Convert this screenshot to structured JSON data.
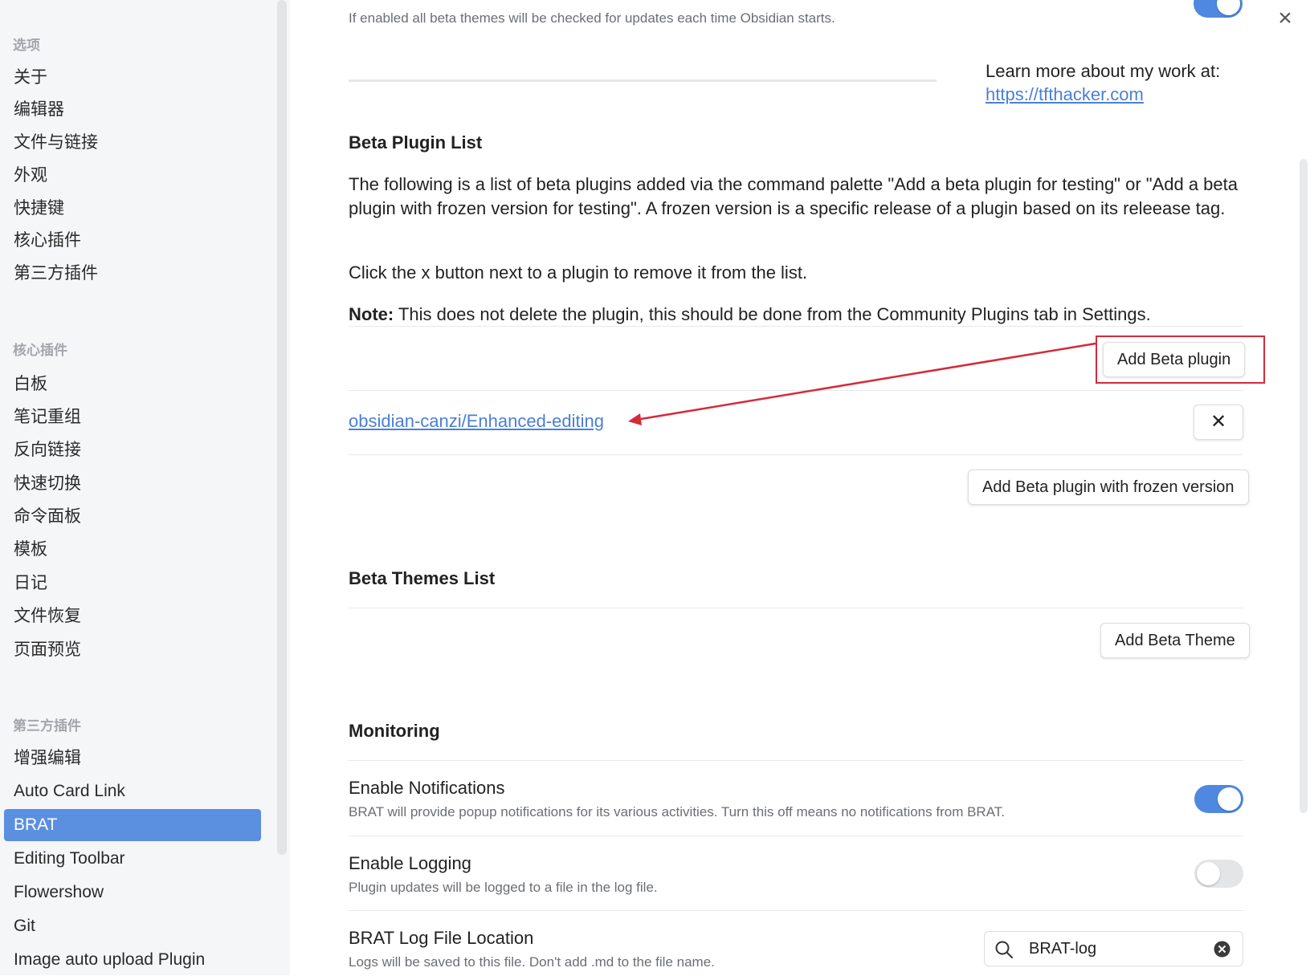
{
  "sidebar": {
    "sections": [
      {
        "title": "选项",
        "items": [
          "关于",
          "编辑器",
          "文件与链接",
          "外观",
          "快捷键",
          "核心插件",
          "第三方插件"
        ]
      },
      {
        "title": "核心插件",
        "items": [
          "白板",
          "笔记重组",
          "反向链接",
          "快速切换",
          "命令面板",
          "模板",
          "日记",
          "文件恢复",
          "页面预览"
        ]
      },
      {
        "title": "第三方插件",
        "items": [
          "增强编辑",
          "Auto Card Link",
          "BRAT",
          "Editing Toolbar",
          "Flowershow",
          "Git",
          "Image auto upload Plugin"
        ]
      }
    ],
    "active_item": "BRAT"
  },
  "top": {
    "theme_update_desc": "If enabled all beta themes will be checked for updates each time Obsidian starts.",
    "learn_more": "Learn more about my work at:",
    "learn_more_link": "https://tfthacker.com"
  },
  "plugin_list": {
    "heading": "Beta Plugin List",
    "para1": "The following is a list of beta plugins added via the command palette \"Add a beta plugin for testing\" or \"Add a beta plugin with frozen version for testing\". A frozen version is a specific release of a plugin based on its releease tag.",
    "para2": "Click the x button next to a plugin to remove it from the list.",
    "note_label": "Note:",
    "note_text": " This does not delete the plugin, this should be done from the Community Plugins tab in Settings.",
    "add_button": "Add Beta plugin",
    "plugin_entry": "obsidian-canzi/Enhanced-editing",
    "remove_button": "✕",
    "frozen_button": "Add Beta plugin with frozen version"
  },
  "themes_list": {
    "heading": "Beta Themes List",
    "add_button": "Add Beta Theme"
  },
  "monitoring": {
    "heading": "Monitoring",
    "notifications_name": "Enable Notifications",
    "notifications_desc": "BRAT will provide popup notifications for its various activities. Turn this off means no notifications from BRAT.",
    "notifications_on": true,
    "logging_name": "Enable Logging",
    "logging_desc": "Plugin updates will be logged to a file in the log file.",
    "logging_on": false,
    "log_location_name": "BRAT Log File Location",
    "log_location_desc": "Logs will be saved to this file. Don't add .md to the file name.",
    "log_location_value": "BRAT-log"
  },
  "colors": {
    "accent": "#5b8fe0",
    "toggle_on": "#4f88e0",
    "annotation": "#d42a3a",
    "link": "#4a7fd6"
  }
}
